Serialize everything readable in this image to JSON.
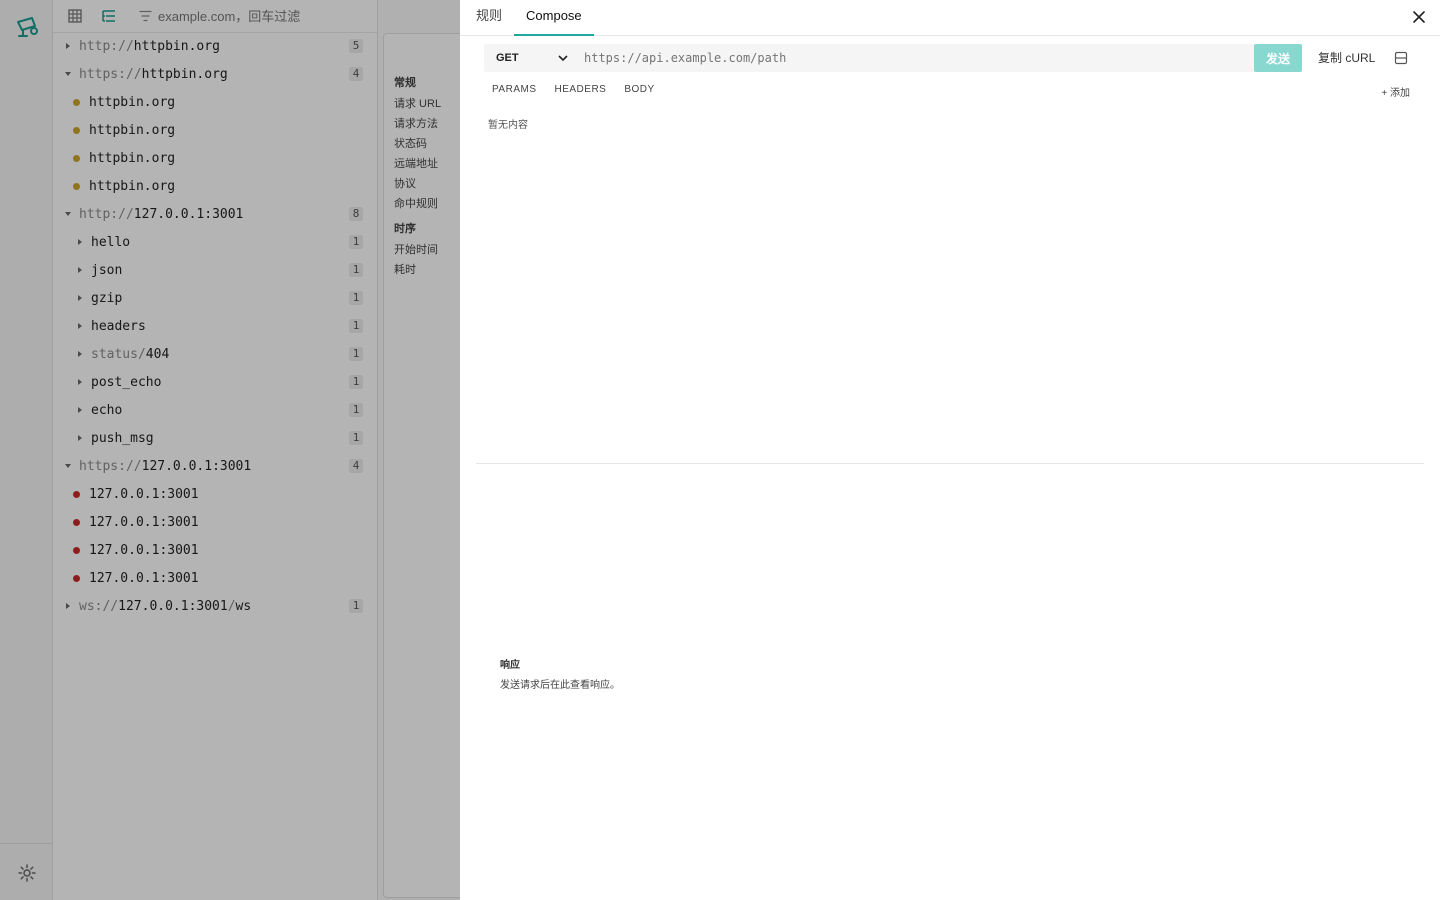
{
  "filter": {
    "placeholder": "example.com，回车过滤"
  },
  "tree": [
    {
      "level": 0,
      "caret": "right",
      "scheme": "http://",
      "host": "httpbin.org",
      "count": "5"
    },
    {
      "level": 0,
      "caret": "down",
      "scheme": "https://",
      "host": "httpbin.org",
      "count": "4"
    },
    {
      "level": 1,
      "dot": "#c9a227",
      "label": "httpbin.org"
    },
    {
      "level": 1,
      "dot": "#c9a227",
      "label": "httpbin.org"
    },
    {
      "level": 1,
      "dot": "#c9a227",
      "label": "httpbin.org"
    },
    {
      "level": 1,
      "dot": "#c9a227",
      "label": "httpbin.org"
    },
    {
      "level": 0,
      "caret": "down",
      "scheme": "http://",
      "host": "127.0.0.1:3001",
      "count": "8"
    },
    {
      "level": 1,
      "caret": "right",
      "label": "hello",
      "count": "1"
    },
    {
      "level": 1,
      "caret": "right",
      "label": "json",
      "count": "1"
    },
    {
      "level": 1,
      "caret": "right",
      "label": "gzip",
      "count": "1"
    },
    {
      "level": 1,
      "caret": "right",
      "label": "headers",
      "count": "1"
    },
    {
      "level": 1,
      "caret": "right",
      "scheme": "status/",
      "host": "404",
      "count": "1"
    },
    {
      "level": 1,
      "caret": "right",
      "label": "post_echo",
      "count": "1"
    },
    {
      "level": 1,
      "caret": "right",
      "label": "echo",
      "count": "1"
    },
    {
      "level": 1,
      "caret": "right",
      "label": "push_msg",
      "count": "1"
    },
    {
      "level": 0,
      "caret": "down",
      "scheme": "https://",
      "host": "127.0.0.1:3001",
      "count": "4"
    },
    {
      "level": 1,
      "dot": "#c62828",
      "label": "127.0.0.1:3001"
    },
    {
      "level": 1,
      "dot": "#c62828",
      "label": "127.0.0.1:3001"
    },
    {
      "level": 1,
      "dot": "#c62828",
      "label": "127.0.0.1:3001"
    },
    {
      "level": 1,
      "dot": "#c62828",
      "label": "127.0.0.1:3001"
    },
    {
      "level": 0,
      "caret": "right",
      "scheme": "ws://",
      "host": "127.0.0.1:3001",
      "suffix_scheme": "/",
      "suffix": "ws",
      "count": "1"
    }
  ],
  "detail": {
    "general_title": "常规",
    "general": [
      "请求 URL",
      "请求方法",
      "状态码",
      "远端地址",
      "协议",
      "命中规则"
    ],
    "timing_title": "时序",
    "timing": [
      "开始时间",
      "耗时"
    ]
  },
  "drawer": {
    "tabs": [
      "规则",
      "Compose"
    ],
    "active_tab": 1,
    "method": "GET",
    "url_placeholder": "https://api.example.com/path",
    "send_label": "发送",
    "copy_label": "复制 cURL",
    "subtabs": [
      "PARAMS",
      "HEADERS",
      "BODY"
    ],
    "add_label": "+ 添加",
    "empty_label": "暂无内容",
    "response_title": "响应",
    "response_hint": "发送请求后在此查看响应。"
  },
  "colors": {
    "accent": "#20a99c",
    "send_disabled": "#88d8d0",
    "warn_dot": "#c9a227",
    "error_dot": "#c62828"
  }
}
